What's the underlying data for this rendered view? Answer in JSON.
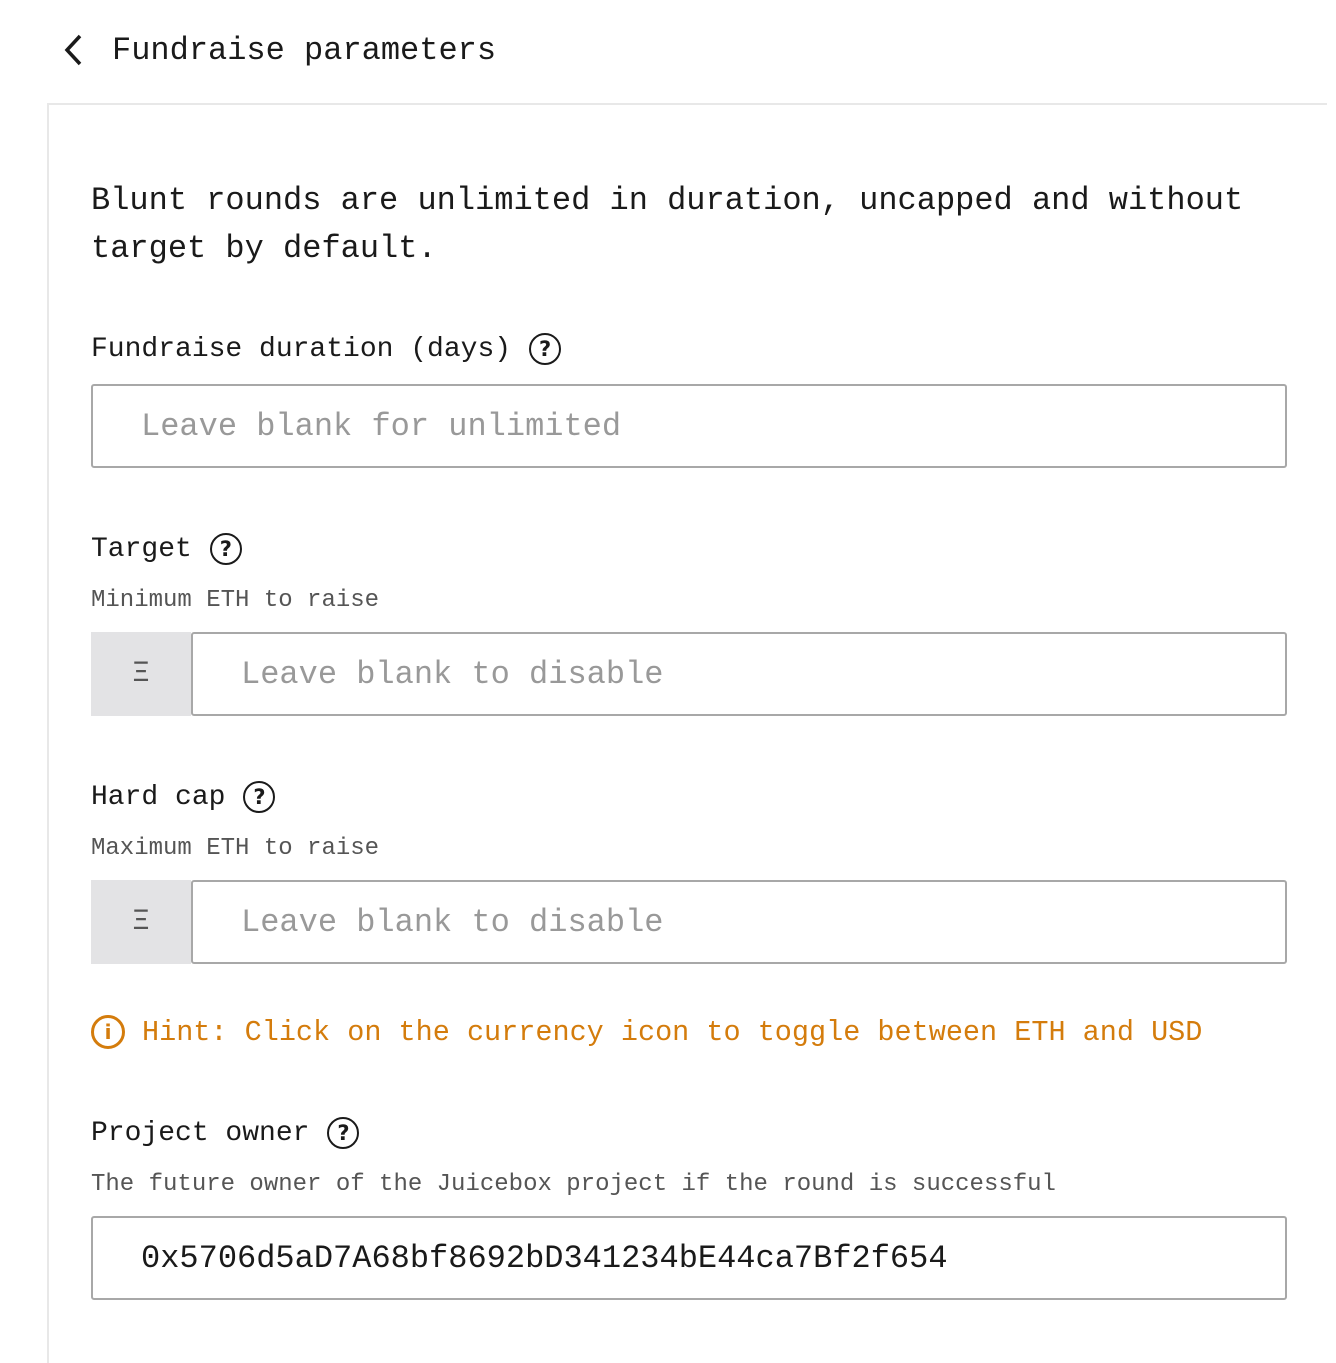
{
  "header": {
    "title": "Fundraise parameters",
    "back_icon": "chevron-left-icon"
  },
  "intro": "Blunt rounds are unlimited in duration, uncapped and without target by default.",
  "duration": {
    "label": "Fundraise duration (days)",
    "placeholder": "Leave blank for unlimited",
    "value": ""
  },
  "target": {
    "label": "Target",
    "description": "Minimum ETH to raise",
    "currency_symbol": "Ξ",
    "placeholder": "Leave blank to disable",
    "value": ""
  },
  "hard_cap": {
    "label": "Hard cap",
    "description": "Maximum ETH to raise",
    "currency_symbol": "Ξ",
    "placeholder": "Leave blank to disable",
    "value": ""
  },
  "hint": {
    "text": "Hint: Click on the currency icon to toggle between ETH and USD",
    "color": "#d47c0c"
  },
  "project_owner": {
    "label": "Project owner",
    "description": "The future owner of the Juicebox project if the round is successful",
    "value": "0x5706d5aD7A68bf8692bD341234bE44ca7Bf2f654"
  },
  "help_symbol": "?",
  "info_symbol": "i"
}
